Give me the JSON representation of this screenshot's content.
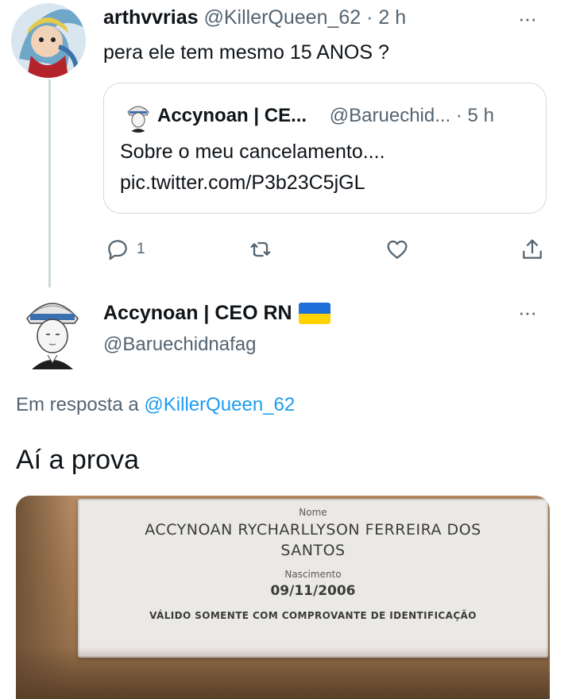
{
  "reply_tweet": {
    "display_name": "arthvvrias",
    "handle": "@KillerQueen_62",
    "time": "· 2 h",
    "more": "···",
    "text": "pera ele tem mesmo 15 ANOS ?",
    "quoted": {
      "display_name": "Accynoan | CE...",
      "handle": "@Baruechid...",
      "time": "· 5 h",
      "line1": "Sobre o meu cancelamento....",
      "line2": "pic.twitter.com/P3b23C5jGL"
    },
    "actions": {
      "reply_count": "1",
      "reply_icon": "reply-icon",
      "retweet_icon": "retweet-icon",
      "like_icon": "heart-icon",
      "share_icon": "share-icon"
    }
  },
  "main_tweet": {
    "display_name": "Accynoan | CEO RN",
    "flag": "ukraine-flag",
    "handle": "@Baruechidnafag",
    "more": "···",
    "reply_to_prefix": "Em resposta a",
    "reply_to_handle": "@KillerQueen_62",
    "text": "Aí a prova",
    "photo": {
      "nome_label": "Nome",
      "name_line1": "ACCYNOAN RYCHARLLYSON FERREIRA DOS",
      "name_line2": "SANTOS",
      "nascimento_label": "Nascimento",
      "date": "09/11/2006",
      "validity": "VÁLIDO SOMENTE COM COMPROVANTE DE IDENTIFICAÇÃO"
    }
  },
  "colors": {
    "muted": "#536471",
    "link": "#1d9bf0",
    "border": "#cfd9de"
  }
}
